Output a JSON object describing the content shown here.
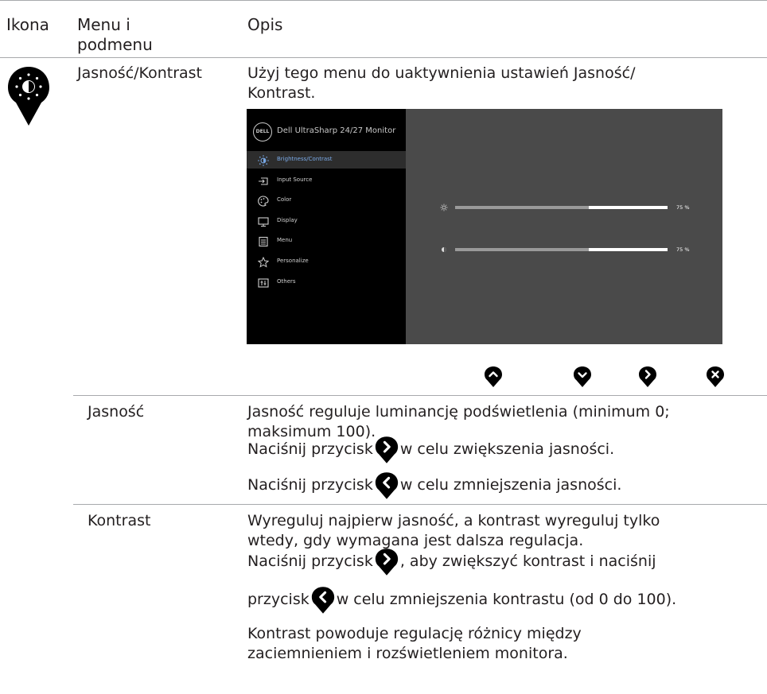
{
  "header": {
    "col_icon": "Ikona",
    "col_menu": "Menu i podmenu",
    "col_desc": "Opis"
  },
  "brightness_contrast": {
    "menu_name": "Jasność/Kontrast",
    "description": "Użyj tego menu do uaktywnienia ustawień Jasność/ Kontrast."
  },
  "osd": {
    "logo": "DELL",
    "title": "Dell UltraSharp 24/27 Monitor",
    "menu_items": [
      {
        "label": "Brightness/Contrast",
        "icon": "brightness-icon",
        "active": true
      },
      {
        "label": "Input Source",
        "icon": "input-source-icon",
        "active": false
      },
      {
        "label": "Color",
        "icon": "color-icon",
        "active": false
      },
      {
        "label": "Display",
        "icon": "display-icon",
        "active": false
      },
      {
        "label": "Menu",
        "icon": "menu-icon",
        "active": false
      },
      {
        "label": "Personalize",
        "icon": "star-icon",
        "active": false
      },
      {
        "label": "Others",
        "icon": "others-icon",
        "active": false
      }
    ],
    "brightness": {
      "value": 0.75,
      "label": "75 %"
    },
    "contrast": {
      "value": 0.75,
      "label": "75 %"
    },
    "colors": {
      "panel": "#4a4a4a",
      "sidebar": "#000000",
      "active_text": "#79a9e6"
    }
  },
  "nav_buttons": [
    "up-button-icon",
    "down-button-icon",
    "right-button-icon",
    "exit-button-icon"
  ],
  "brightness": {
    "name": "Jasność",
    "desc": "Jasność reguluje luminancję podświetlenia (minimum 0; maksimum 100).",
    "inc_prefix": "Naciśnij przycisk",
    "inc_suffix": "w celu zwiększenia jasności.",
    "dec_prefix": "Naciśnij przycisk",
    "dec_suffix": "w celu zmniejszenia jasności."
  },
  "contrast": {
    "name": "Kontrast",
    "desc": "Wyreguluj najpierw jasność, a kontrast wyreguluj tylko wtedy, gdy wymagana jest dalsza regulacja.",
    "inc_prefix": "Naciśnij przycisk",
    "inc_suffix": ", aby zwiększyć kontrast i naciśnij",
    "dec_prefix": "przycisk",
    "dec_suffix": "w celu zmniejszenia kontrastu (od 0 do 100).",
    "note": "Kontrast powoduje regulację różnicy między zaciemnieniem i rozświetleniem monitora."
  }
}
